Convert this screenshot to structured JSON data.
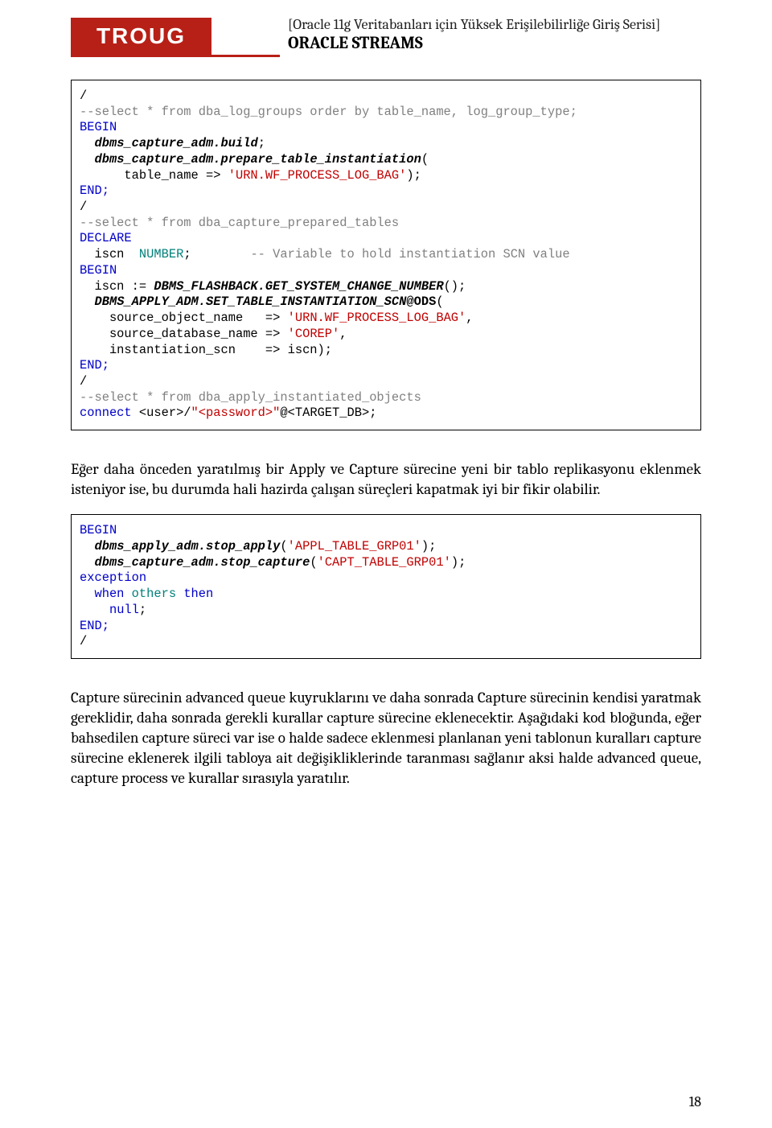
{
  "header": {
    "logo": "TROUG",
    "series": "[Oracle 11g Veritabanları için Yüksek Erişilebilirliğe Giriş Serisi]",
    "topic": "ORACLE STREAMS"
  },
  "code1": {
    "l1": "/",
    "l2": "--select * from dba_log_groups order by table_name, log_group_type;",
    "l3": "",
    "l4a": "BEGIN",
    "l5a": "  ",
    "l5b": "dbms_capture_adm.build",
    "l5c": ";",
    "l6a": "  ",
    "l6b": "dbms_capture_adm.prepare_table_instantiation",
    "l6c": "(",
    "l7a": "      table_name => ",
    "l7b": "'URN.WF_PROCESS_LOG_BAG'",
    "l7c": ");",
    "l8": "END;",
    "l9": "/",
    "l10": "--select * from dba_capture_prepared_tables",
    "l11": "",
    "l12": "DECLARE",
    "l13a": "  iscn  ",
    "l13b": "NUMBER",
    "l13c": ";        ",
    "l13d": "-- Variable to hold instantiation SCN value",
    "l14": "BEGIN",
    "l15a": "  iscn := ",
    "l15b": "DBMS_FLASHBACK.GET_SYSTEM_CHANGE_NUMBER",
    "l15c": "();",
    "l16a": "  ",
    "l16b": "DBMS_APPLY_ADM.SET_TABLE_INSTANTIATION_SCN",
    "l16c": "@ODS",
    "l16d": "(",
    "l17a": "    source_object_name   => ",
    "l17b": "'URN.WF_PROCESS_LOG_BAG'",
    "l17c": ",",
    "l18a": "    source_database_name => ",
    "l18b": "'COREP'",
    "l18c": ",",
    "l19": "    instantiation_scn    => iscn);",
    "l20": "END;",
    "l21": "/",
    "l22": "--select * from dba_apply_instantiated_objects",
    "l23": "",
    "l24a": "connect",
    "l24b": " <user>/",
    "l24c": "\"<password>\"",
    "l24d": "@<TARGET_DB>;"
  },
  "para1": "Eğer daha önceden yaratılmış bir Apply ve Capture sürecine yeni bir tablo replikasyonu eklenmek isteniyor ise, bu durumda hali hazirda çalışan süreçleri kapatmak iyi bir fikir olabilir.",
  "code2": {
    "l1": "BEGIN",
    "l2a": "  ",
    "l2b": "dbms_apply_adm.stop_apply",
    "l2c": "(",
    "l2d": "'APPL_TABLE_GRP01'",
    "l2e": ");",
    "l3a": "  ",
    "l3b": "dbms_capture_adm.stop_capture",
    "l3c": "(",
    "l3d": "'CAPT_TABLE_GRP01'",
    "l3e": ");",
    "l4": "exception",
    "l5a": "  when ",
    "l5b": "others",
    "l5c": " then",
    "l6a": "    ",
    "l6b": "null",
    "l6c": ";",
    "l7": "END;",
    "l8": "/"
  },
  "para2": "Capture sürecinin advanced queue kuyruklarını ve daha sonrada Capture sürecinin kendisi yaratmak gereklidir, daha sonrada gerekli kurallar capture sürecine eklenecektir. Aşağıdaki kod bloğunda, eğer bahsedilen capture süreci var ise o halde sadece eklenmesi planlanan yeni tablonun kuralları capture sürecine eklenerek ilgili tabloya ait değişikliklerinde taranması sağlanır aksi halde advanced queue, capture process ve kurallar sırasıyla yaratılır.",
  "pagenum": "18"
}
